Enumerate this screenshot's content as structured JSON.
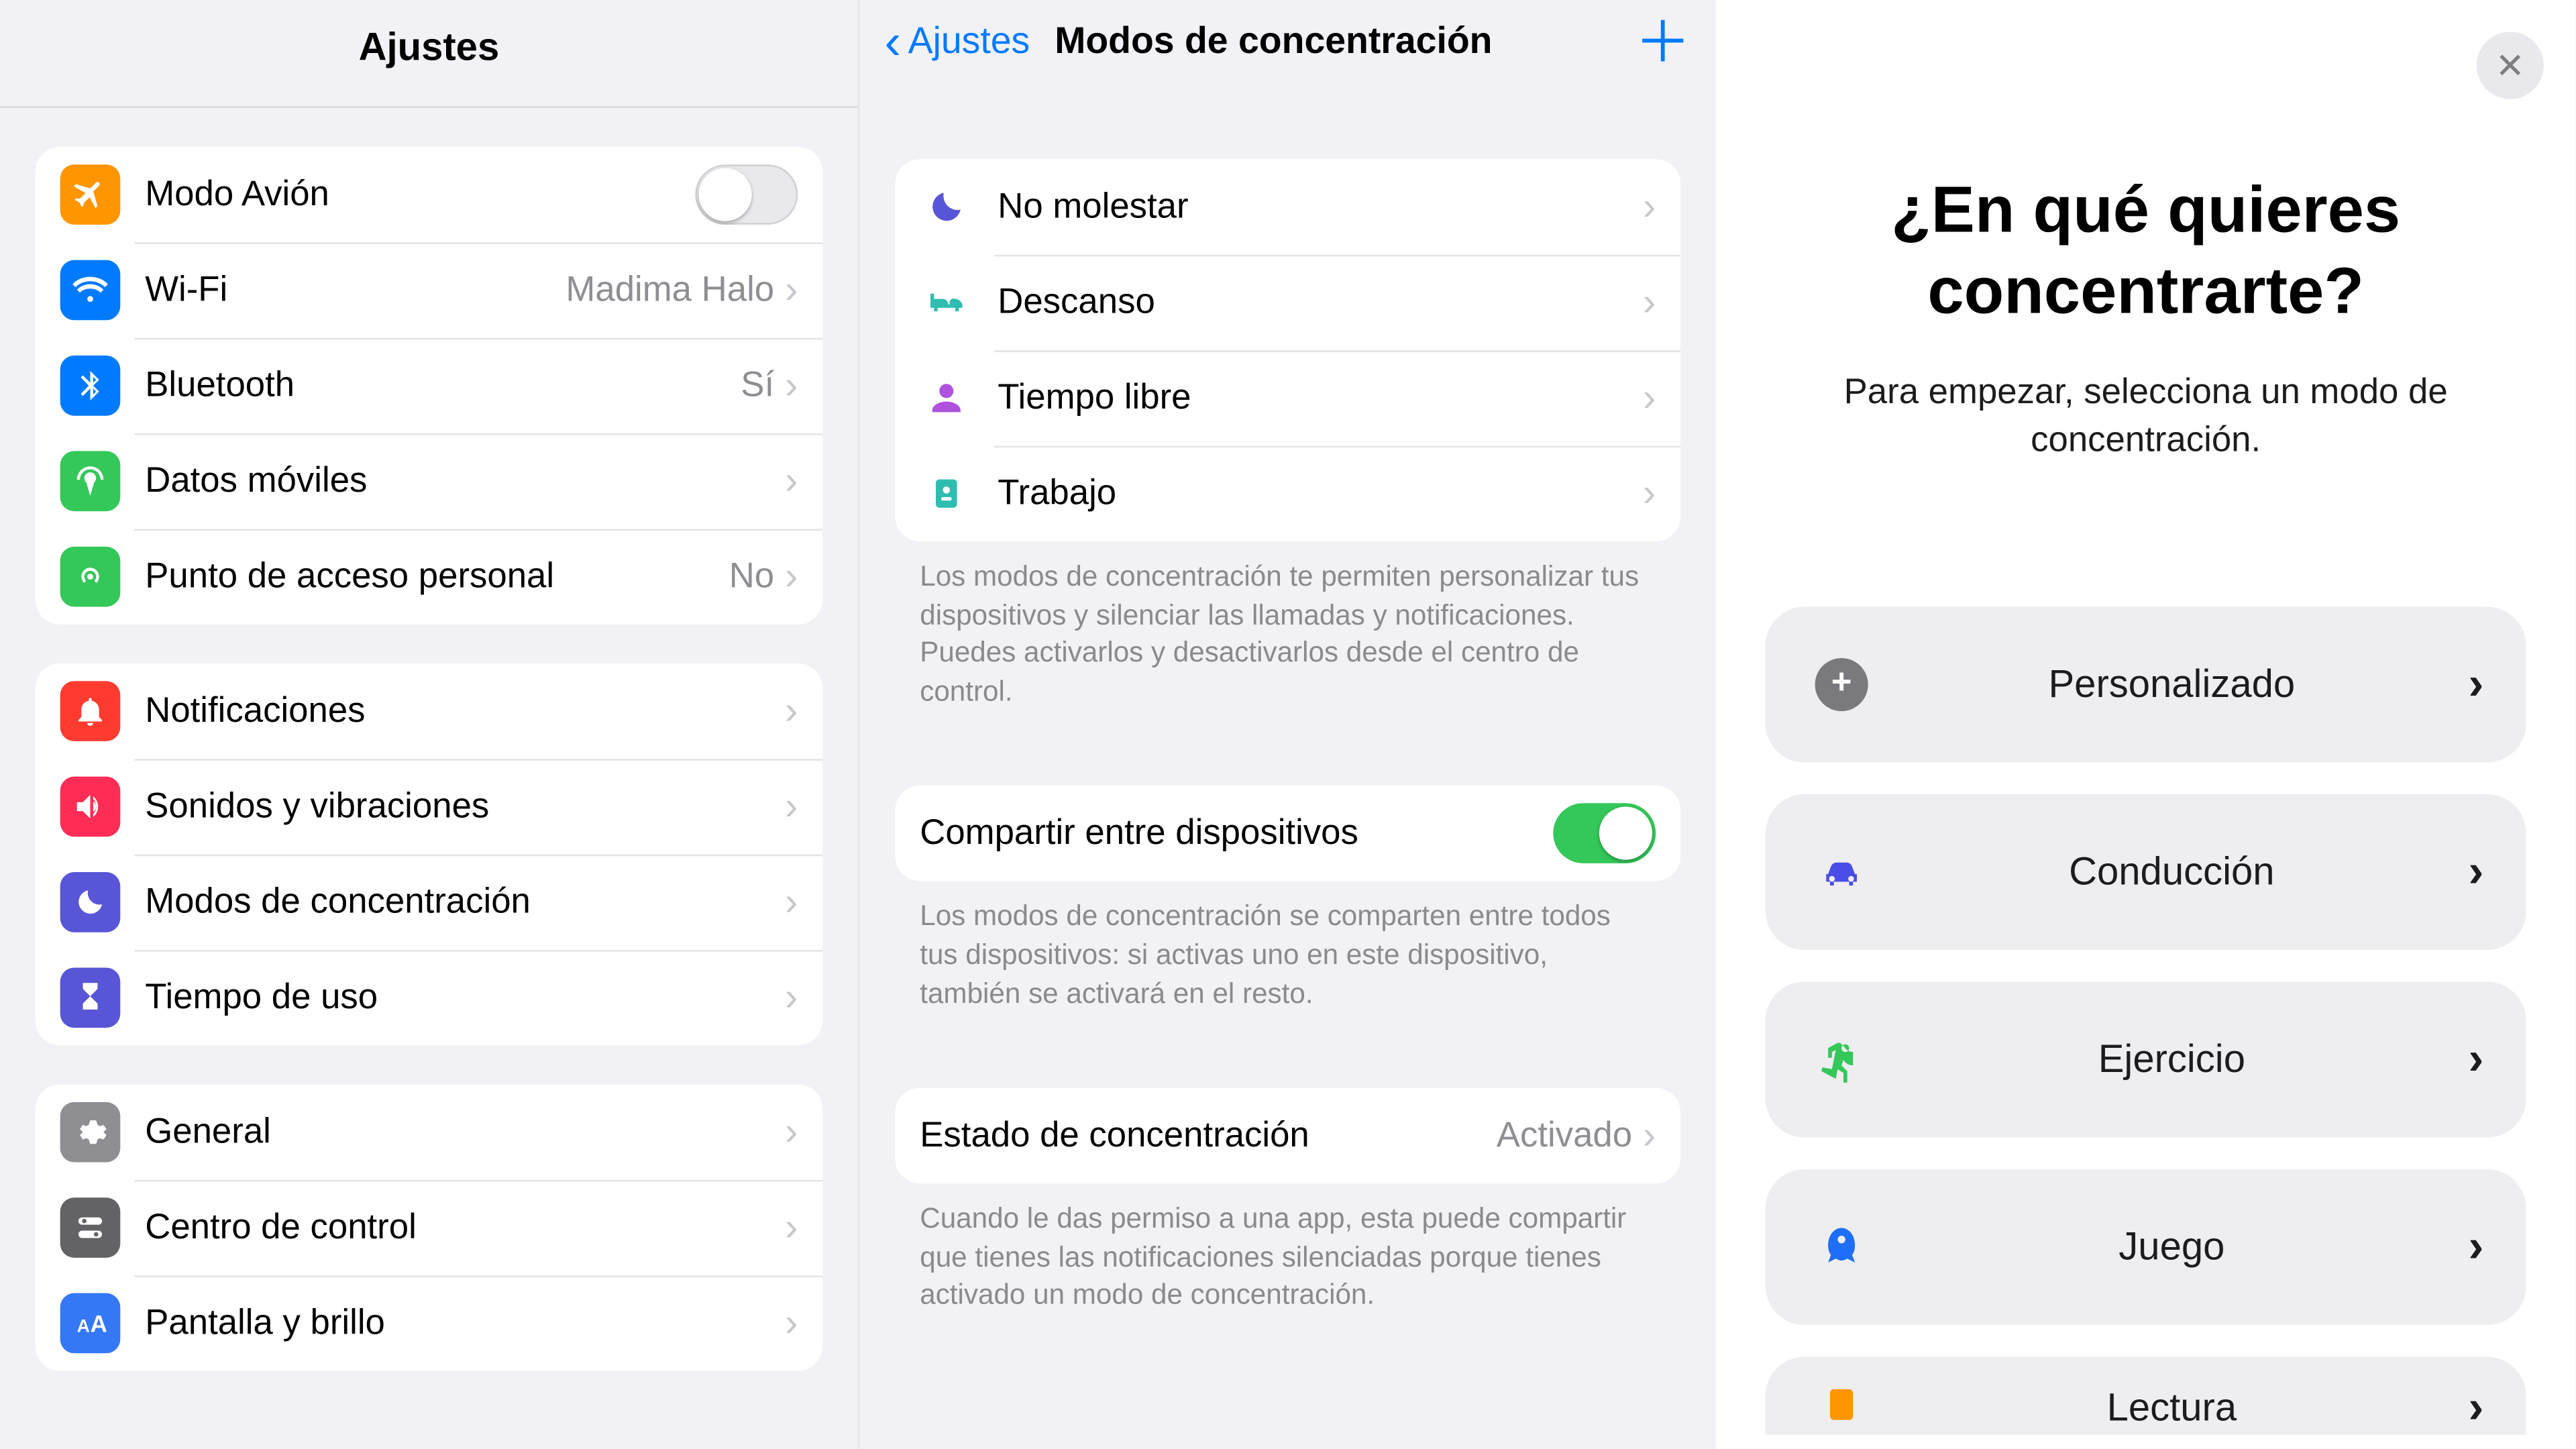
{
  "left": {
    "title": "Ajustes",
    "group1": [
      {
        "label": "Modo Avión",
        "value": "",
        "toggle": true,
        "toggleOn": false
      },
      {
        "label": "Wi-Fi",
        "value": "Madima Halo",
        "chev": true
      },
      {
        "label": "Bluetooth",
        "value": "Sí",
        "chev": true
      },
      {
        "label": "Datos móviles",
        "value": "",
        "chev": true
      },
      {
        "label": "Punto de acceso personal",
        "value": "No",
        "chev": true
      }
    ],
    "group2": [
      {
        "label": "Notificaciones"
      },
      {
        "label": "Sonidos y vibraciones"
      },
      {
        "label": "Modos de concentración"
      },
      {
        "label": "Tiempo de uso"
      }
    ],
    "group3": [
      {
        "label": "General"
      },
      {
        "label": "Centro de control"
      },
      {
        "label": "Pantalla y brillo"
      }
    ]
  },
  "middle": {
    "back": "Ajustes",
    "title": "Modos de concentración",
    "modes": [
      {
        "label": "No molestar"
      },
      {
        "label": "Descanso"
      },
      {
        "label": "Tiempo libre"
      },
      {
        "label": "Trabajo"
      }
    ],
    "footnote1": "Los modos de concentración te permiten personalizar tus dispositivos y silenciar las llamadas y notificaciones. Puedes activarlos y desactivarlos desde el centro de control.",
    "share": {
      "label": "Compartir entre dispositivos",
      "on": true
    },
    "footnote2": "Los modos de concentración se comparten entre todos tus dispositivos: si activas uno en este dispositivo, también se activará en el resto.",
    "status": {
      "label": "Estado de concentración",
      "value": "Activado"
    },
    "footnote3": "Cuando le das permiso a una app, esta puede compartir que tienes las notificaciones silenciadas porque tienes activado un modo de concentración."
  },
  "right": {
    "title": "¿En qué quieres concentrarte?",
    "sub": "Para empezar, selecciona un modo de concentración.",
    "options": [
      {
        "label": "Personalizado"
      },
      {
        "label": "Conducción"
      },
      {
        "label": "Ejercicio"
      },
      {
        "label": "Juego"
      },
      {
        "label": "Lectura"
      }
    ]
  }
}
